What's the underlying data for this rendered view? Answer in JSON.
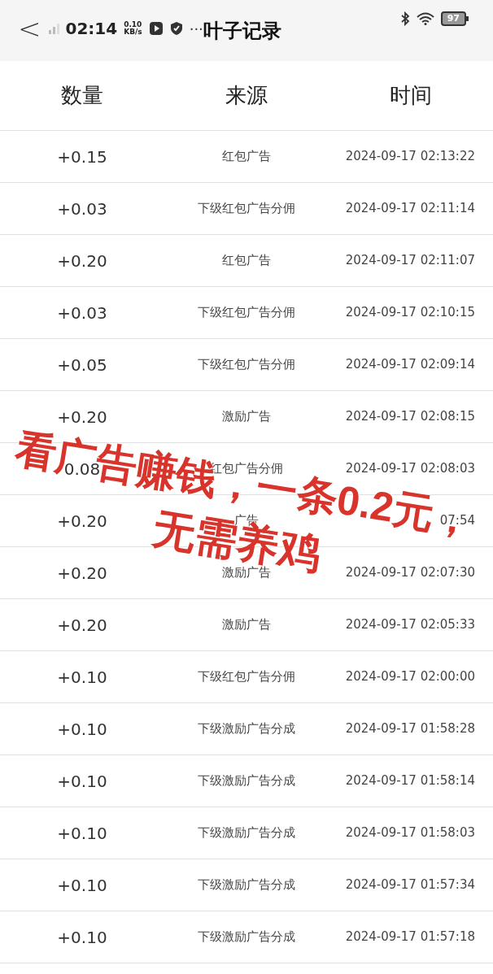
{
  "status_bar": {
    "time": "02:14",
    "speed_value": "0.10",
    "speed_unit": "KB/s",
    "more": "···",
    "battery": "97"
  },
  "header": {
    "back": "<",
    "title": "叶子记录"
  },
  "table": {
    "columns": [
      "数量",
      "来源",
      "时间"
    ],
    "rows": [
      {
        "amount": "+0.15",
        "source": "红包广告",
        "time": "2024-09-17 02:13:22"
      },
      {
        "amount": "+0.03",
        "source": "下级红包广告分佣",
        "time": "2024-09-17 02:11:14"
      },
      {
        "amount": "+0.20",
        "source": "红包广告",
        "time": "2024-09-17 02:11:07"
      },
      {
        "amount": "+0.03",
        "source": "下级红包广告分佣",
        "time": "2024-09-17 02:10:15"
      },
      {
        "amount": "+0.05",
        "source": "下级红包广告分佣",
        "time": "2024-09-17 02:09:14"
      },
      {
        "amount": "+0.20",
        "source": "激励广告",
        "time": "2024-09-17 02:08:15"
      },
      {
        "amount": "0.08",
        "source": "红包广告分佣",
        "time": "2024-09-17 02:08:03"
      },
      {
        "amount": "+0.20",
        "source": "广告",
        "time": "07:54"
      },
      {
        "amount": "+0.20",
        "source": "激励广告",
        "time": "2024-09-17 02:07:30"
      },
      {
        "amount": "+0.20",
        "source": "激励广告",
        "time": "2024-09-17 02:05:33"
      },
      {
        "amount": "+0.10",
        "source": "下级红包广告分佣",
        "time": "2024-09-17 02:00:00"
      },
      {
        "amount": "+0.10",
        "source": "下级激励广告分成",
        "time": "2024-09-17 01:58:28"
      },
      {
        "amount": "+0.10",
        "source": "下级激励广告分成",
        "time": "2024-09-17 01:58:14"
      },
      {
        "amount": "+0.10",
        "source": "下级激励广告分成",
        "time": "2024-09-17 01:58:03"
      },
      {
        "amount": "+0.10",
        "source": "下级激励广告分成",
        "time": "2024-09-17 01:57:34"
      },
      {
        "amount": "+0.10",
        "source": "下级激励广告分成",
        "time": "2024-09-17 01:57:18"
      }
    ]
  },
  "overlay_caption": {
    "lines": [
      "看广告赚钱，一条0.2元，",
      "无需养鸡"
    ]
  }
}
